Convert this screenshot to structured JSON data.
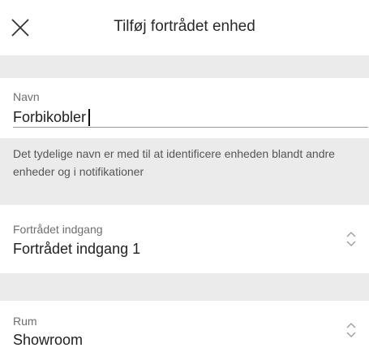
{
  "header": {
    "title": "Tilføj fortrådet enhed"
  },
  "name_field": {
    "label": "Navn",
    "value": "Forbikobler",
    "hint": "Det tydelige navn er med til at identificere enheden blandt andre enheder og i notifikationer"
  },
  "wired_input": {
    "label": "Fortrådet indgang",
    "value": "Fortrådet indgang 1"
  },
  "room": {
    "label": "Rum",
    "value": "Showroom"
  }
}
